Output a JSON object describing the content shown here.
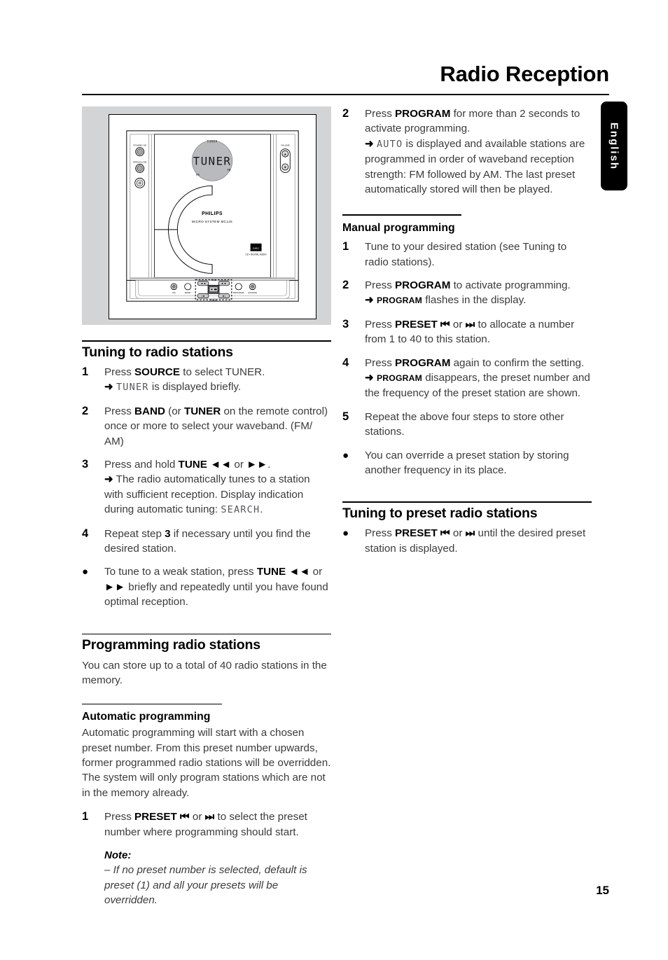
{
  "page": {
    "title": "Radio Reception",
    "number": "15",
    "language_tab": "English"
  },
  "illustration": {
    "name": "micro-system-front-panel",
    "display_text": "TUNER",
    "display_label_top": "TUNER",
    "display_label_left": "FM",
    "display_label_right": "PM",
    "brand": "PHILIPS",
    "model_text": "MICRO SYSTEM MC145",
    "disc_logo": "COMPACT DISC",
    "disc_logo_sub": "CD • DIGITAL AUDIO",
    "left_controls": [
      {
        "label": "STANDBY-ON",
        "type": "button"
      },
      {
        "label": "OPEN•CLOSE",
        "type": "button"
      },
      {
        "label": "dial",
        "type": "dial"
      }
    ],
    "right_controls": [
      {
        "label": "VOLUME",
        "type": "rocker"
      }
    ],
    "bottom_controls": [
      {
        "label": "FM",
        "type": "knob"
      },
      {
        "label": "BAND",
        "type": "button"
      },
      {
        "label": "TUNE ◄◄",
        "type": "button"
      },
      {
        "label": "TUNE ►►",
        "type": "button"
      },
      {
        "label": "PRESET |◄",
        "type": "button"
      },
      {
        "label": "PRESET ►|",
        "type": "button"
      },
      {
        "label": "PROGRAM",
        "type": "button"
      },
      {
        "label": "SOURCE",
        "type": "knob"
      }
    ]
  },
  "left_column": {
    "section1": {
      "heading": "Tuning to radio stations",
      "steps": [
        {
          "marker": "1",
          "lines": [
            {
              "type": "text",
              "segments": [
                {
                  "t": "Press ",
                  "s": "plain"
                },
                {
                  "t": "SOURCE",
                  "s": "bold"
                },
                {
                  "t": " to select TUNER.",
                  "s": "plain"
                }
              ]
            },
            {
              "type": "arrow",
              "segments": [
                {
                  "t": "TUNER",
                  "s": "lcd"
                },
                {
                  "t": " is displayed briefly.",
                  "s": "plain"
                }
              ]
            }
          ]
        },
        {
          "marker": "2",
          "lines": [
            {
              "type": "text",
              "segments": [
                {
                  "t": "Press ",
                  "s": "plain"
                },
                {
                  "t": "BAND",
                  "s": "bold"
                },
                {
                  "t": " (or ",
                  "s": "plain"
                },
                {
                  "t": "TUNER",
                  "s": "bold"
                },
                {
                  "t": " on the remote control) once or more to select your waveband. (FM/ AM)",
                  "s": "plain"
                }
              ]
            }
          ]
        },
        {
          "marker": "3",
          "lines": [
            {
              "type": "text",
              "segments": [
                {
                  "t": "Press and hold ",
                  "s": "plain"
                },
                {
                  "t": "TUNE ◄◄",
                  "s": "bold"
                },
                {
                  "t": " or ",
                  "s": "plain"
                },
                {
                  "t": "►►",
                  "s": "bold"
                },
                {
                  "t": ".",
                  "s": "plain"
                }
              ]
            },
            {
              "type": "arrow",
              "segments": [
                {
                  "t": "The radio automatically tunes to a station with sufficient reception. Display indication during automatic tuning: ",
                  "s": "plain"
                },
                {
                  "t": "SEARCH",
                  "s": "lcd"
                },
                {
                  "t": ".",
                  "s": "plain"
                }
              ]
            }
          ]
        },
        {
          "marker": "4",
          "lines": [
            {
              "type": "text",
              "segments": [
                {
                  "t": "Repeat step ",
                  "s": "plain"
                },
                {
                  "t": "3",
                  "s": "bold"
                },
                {
                  "t": " if necessary until you find the desired station.",
                  "s": "plain"
                }
              ]
            }
          ]
        },
        {
          "marker": "●",
          "lines": [
            {
              "type": "text",
              "segments": [
                {
                  "t": "To tune to a weak station, press ",
                  "s": "plain"
                },
                {
                  "t": "TUNE ◄◄",
                  "s": "bold"
                },
                {
                  "t": " or ",
                  "s": "plain"
                },
                {
                  "t": "►►",
                  "s": "bold"
                },
                {
                  "t": " briefly and repeatedly until you have found optimal reception.",
                  "s": "plain"
                }
              ]
            }
          ]
        }
      ]
    },
    "section2": {
      "heading": "Programming radio stations",
      "intro": "You can store up to a total of 40 radio stations in the memory.",
      "subheading": "Automatic programming",
      "sub_intro": "Automatic programming will start with a chosen preset number. From this preset number upwards, former programmed radio stations will be overridden. The system will only program stations which are not in the memory already.",
      "steps": [
        {
          "marker": "1",
          "lines": [
            {
              "type": "text",
              "segments": [
                {
                  "t": "Press ",
                  "s": "plain"
                },
                {
                  "t": "PRESET",
                  "s": "bold"
                },
                {
                  "t": " ⏮",
                  "s": "glyph"
                },
                {
                  "t": " or ",
                  "s": "plain"
                },
                {
                  "t": "⏭",
                  "s": "glyph"
                },
                {
                  "t": " to select the preset number where programming should start.",
                  "s": "plain"
                }
              ]
            }
          ]
        }
      ],
      "note_head": "Note:",
      "note_body": "–  If no preset number is selected, default is preset (1) and all your presets will be overridden."
    }
  },
  "right_column": {
    "continued_step": {
      "marker": "2",
      "lines": [
        {
          "type": "text",
          "segments": [
            {
              "t": "Press ",
              "s": "plain"
            },
            {
              "t": "PROGRAM",
              "s": "bold"
            },
            {
              "t": " for more than 2 seconds to activate programming.",
              "s": "plain"
            }
          ]
        },
        {
          "type": "arrow",
          "segments": [
            {
              "t": "AUTO",
              "s": "lcd"
            },
            {
              "t": " is displayed and available stations are programmed in order of waveband reception strength: FM followed by AM. The last preset automatically stored will then be played.",
              "s": "plain"
            }
          ]
        }
      ]
    },
    "section1": {
      "subheading": "Manual programming",
      "steps": [
        {
          "marker": "1",
          "lines": [
            {
              "type": "text",
              "segments": [
                {
                  "t": "Tune to your desired station (see Tuning to radio stations).",
                  "s": "plain"
                }
              ]
            }
          ]
        },
        {
          "marker": "2",
          "lines": [
            {
              "type": "text",
              "segments": [
                {
                  "t": "Press ",
                  "s": "plain"
                },
                {
                  "t": "PROGRAM",
                  "s": "bold"
                },
                {
                  "t": " to activate programming.",
                  "s": "plain"
                }
              ]
            },
            {
              "type": "arrow",
              "segments": [
                {
                  "t": "PROGRAM",
                  "s": "smallcaps"
                },
                {
                  "t": " flashes in the display.",
                  "s": "plain"
                }
              ]
            }
          ]
        },
        {
          "marker": "3",
          "lines": [
            {
              "type": "text",
              "segments": [
                {
                  "t": "Press ",
                  "s": "plain"
                },
                {
                  "t": "PRESET",
                  "s": "bold"
                },
                {
                  "t": " ⏮",
                  "s": "glyph"
                },
                {
                  "t": " or ",
                  "s": "plain"
                },
                {
                  "t": "⏭",
                  "s": "glyph"
                },
                {
                  "t": " to allocate a number from 1 to 40 to this station.",
                  "s": "plain"
                }
              ]
            }
          ]
        },
        {
          "marker": "4",
          "lines": [
            {
              "type": "text",
              "segments": [
                {
                  "t": "Press ",
                  "s": "plain"
                },
                {
                  "t": "PROGRAM",
                  "s": "bold"
                },
                {
                  "t": " again to confirm the setting.",
                  "s": "plain"
                }
              ]
            },
            {
              "type": "arrow",
              "segments": [
                {
                  "t": "PROGRAM",
                  "s": "smallcaps"
                },
                {
                  "t": " disappears, the preset number and the frequency of the preset station are shown.",
                  "s": "plain"
                }
              ]
            }
          ]
        },
        {
          "marker": "5",
          "lines": [
            {
              "type": "text",
              "segments": [
                {
                  "t": "Repeat the above four steps to store other stations.",
                  "s": "plain"
                }
              ]
            }
          ]
        },
        {
          "marker": "●",
          "lines": [
            {
              "type": "text",
              "segments": [
                {
                  "t": "You can override a preset station by storing another frequency in its place.",
                  "s": "plain"
                }
              ]
            }
          ]
        }
      ]
    },
    "section2": {
      "heading": "Tuning to preset radio stations",
      "steps": [
        {
          "marker": "●",
          "lines": [
            {
              "type": "text",
              "segments": [
                {
                  "t": "Press ",
                  "s": "plain"
                },
                {
                  "t": "PRESET",
                  "s": "bold"
                },
                {
                  "t": " ⏮",
                  "s": "glyph"
                },
                {
                  "t": " or ",
                  "s": "plain"
                },
                {
                  "t": "⏭",
                  "s": "glyph"
                },
                {
                  "t": " until the desired preset station is displayed.",
                  "s": "plain"
                }
              ]
            }
          ]
        }
      ]
    }
  }
}
